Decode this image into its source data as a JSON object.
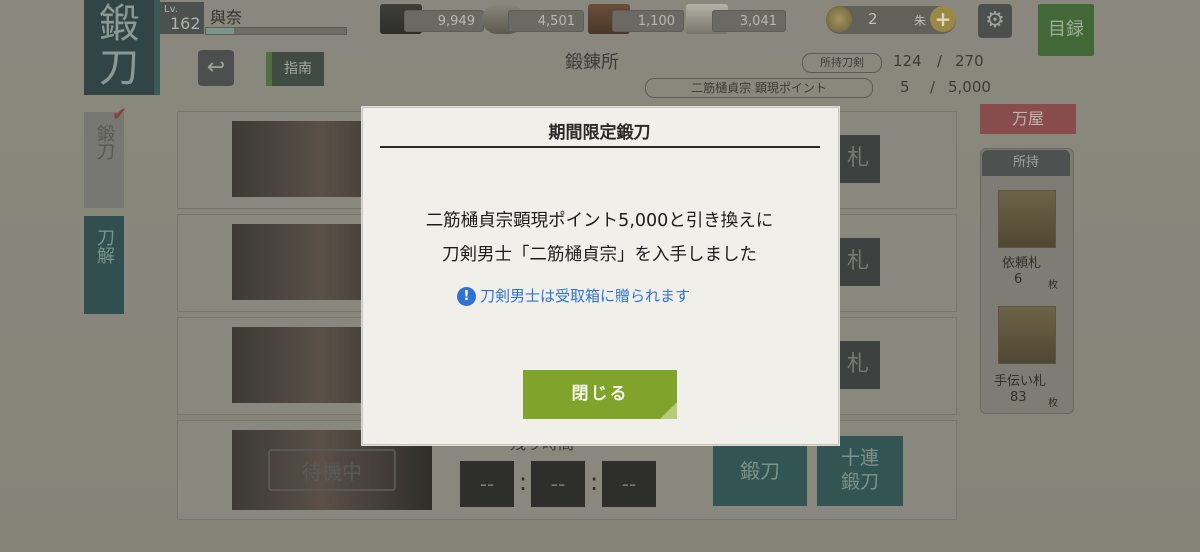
{
  "header": {
    "badge": [
      "鍛",
      "刀"
    ],
    "level_label": "Lv.",
    "level": "162",
    "player_name": "與奈",
    "resources": [
      {
        "icon": "charcoal-icon",
        "value": "9,949"
      },
      {
        "icon": "whetstone-icon",
        "value": "4,501"
      },
      {
        "icon": "steel-icon",
        "value": "1,100"
      },
      {
        "icon": "grindstone-icon",
        "value": "3,041"
      }
    ],
    "coins": {
      "value": "2",
      "unit": "朱",
      "plus": "+"
    },
    "settings_icon": "⚙",
    "catalog_label": "目録"
  },
  "toolbar": {
    "back_icon": "↩",
    "guide_label": "指南",
    "title": "鍛錬所",
    "owned_label": "所持刀剣",
    "owned": "124",
    "sep": "/",
    "owned_max": "270",
    "points_label": "二筋樋貞宗 顕現ポイント",
    "points": "5",
    "points_max": "5,000"
  },
  "side_tabs": {
    "forge": "鍛刀",
    "forge_check": "✔",
    "dismantle": "刀解"
  },
  "slots": {
    "button_text": "札",
    "standby": "待機中",
    "timer_label": "残り時間",
    "timer": [
      "--",
      "--",
      "--"
    ],
    "colon": ":",
    "forge_button": "鍛刀",
    "forge10_button": [
      "十連",
      "鍛刀"
    ]
  },
  "shop": {
    "label": "万屋",
    "inventory_title": "所持",
    "items": [
      {
        "name": "依頼札",
        "count": "6",
        "unit": "枚"
      },
      {
        "name": "手伝い札",
        "count": "83",
        "unit": "枚"
      }
    ]
  },
  "modal": {
    "title": "期間限定鍛刀",
    "line1": "二筋樋貞宗顕現ポイント5,000と引き換えに",
    "line2": "刀剣男士「二筋樋貞宗」を入手しました",
    "notice_icon": "!",
    "notice": "刀剣男士は受取箱に贈られます",
    "close_label": "閉じる"
  },
  "colors": {
    "modal_bg": "#f1efea",
    "notice_blue": "#2f73d2",
    "close_green": "#7fa32b"
  }
}
